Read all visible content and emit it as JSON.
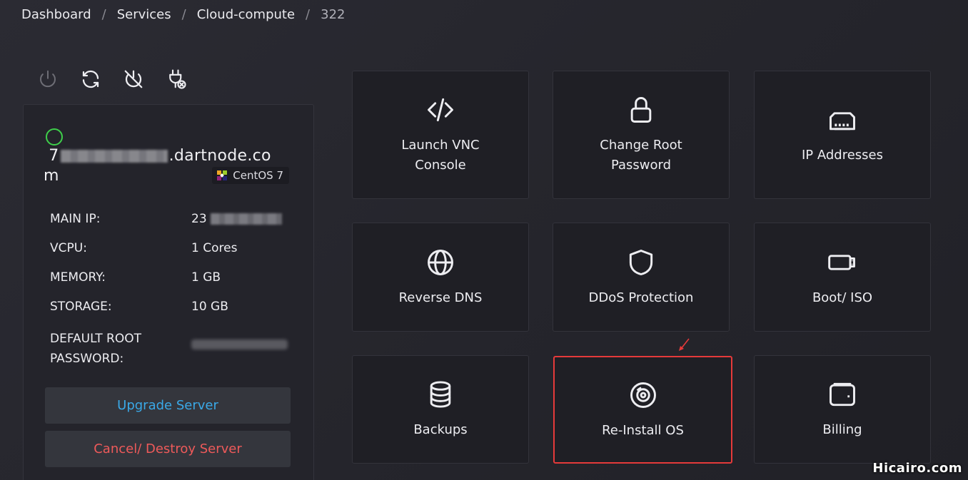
{
  "breadcrumb": {
    "items": [
      "Dashboard",
      "Services",
      "Cloud-compute"
    ],
    "current": "322"
  },
  "server": {
    "status": "online",
    "status_color": "#3ecf4a",
    "hostname_prefix": "7",
    "hostname_suffix": ".dartnode.co",
    "hostname_wrap": "m",
    "os": "CentOS 7",
    "specs": [
      {
        "label": "MAIN IP:",
        "value": "23"
      },
      {
        "label": "VCPU:",
        "value": "1 Cores"
      },
      {
        "label": "MEMORY:",
        "value": "1 GB"
      },
      {
        "label": "STORAGE:",
        "value": "10 GB"
      }
    ],
    "root_password_label_1": "DEFAULT ROOT",
    "root_password_label_2": "PASSWORD:"
  },
  "actions": {
    "upgrade_label": "Upgrade Server",
    "cancel_label": "Cancel/ Destroy Server",
    "upgrade_color": "#3aa9e8",
    "cancel_color": "#ee5a5a"
  },
  "tiles": [
    {
      "label": "Launch VNC\nConsole",
      "icon": "code-icon"
    },
    {
      "label": "Change Root\nPassword",
      "icon": "lock-icon"
    },
    {
      "label": "IP Addresses",
      "icon": "ethernet-icon"
    },
    {
      "label": "Reverse DNS",
      "icon": "globe-icon"
    },
    {
      "label": "DDoS Protection",
      "icon": "shield-icon"
    },
    {
      "label": "Boot/ ISO",
      "icon": "usb-drive-icon"
    },
    {
      "label": "Backups",
      "icon": "database-icon"
    },
    {
      "label": "Re-Install OS",
      "icon": "disc-icon",
      "highlighted": true
    },
    {
      "label": "Billing",
      "icon": "wallet-icon"
    }
  ],
  "highlight_color": "#e53a3a",
  "watermark": "Hicairo.com"
}
